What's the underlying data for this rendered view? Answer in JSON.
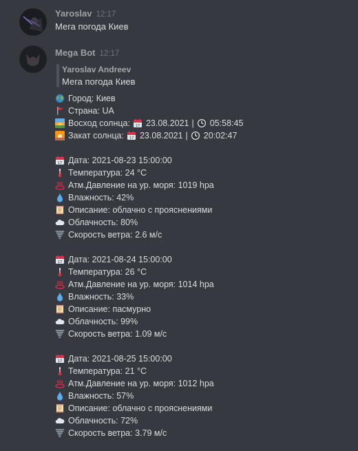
{
  "messages": [
    {
      "author": "Yaroslav",
      "time": "12:17",
      "text": "Мега погода Киев"
    },
    {
      "author": "Mega Bot",
      "time": "12:17",
      "reply": {
        "author": "Yaroslav Andreev",
        "text": "Мега погода Киев"
      },
      "city_label": "Город: Киев",
      "country_label": "Страна: UA",
      "sunrise": {
        "label": "Восход солнца:",
        "date": "23.08.2021",
        "separator": "|",
        "time": "05:58:45"
      },
      "sunset": {
        "label": "Закат солнца:",
        "date": "23.08.2021",
        "separator": "|",
        "time": "20:02:47"
      },
      "forecasts": [
        {
          "date": "Дата: 2021-08-23 15:00:00",
          "temperature": "Температура: 24 °C",
          "pressure": "Атм.Давление на ур. моря: 1019 hpa",
          "humidity": "Влажность: 42%",
          "description": "Описание: облачно с прояснениями",
          "clouds": "Облачность: 80%",
          "wind": "Скорость ветра: 2.6 м/с"
        },
        {
          "date": "Дата: 2021-08-24 15:00:00",
          "temperature": "Температура: 26 °C",
          "pressure": "Атм.Давление на ур. моря: 1014 hpa",
          "humidity": "Влажность: 33%",
          "description": "Описание: пасмурно",
          "clouds": "Облачность: 99%",
          "wind": "Скорость ветра: 1.09 м/с"
        },
        {
          "date": "Дата: 2021-08-25 15:00:00",
          "temperature": "Температура: 21 °C",
          "pressure": "Атм.Давление на ур. моря: 1012 hpa",
          "humidity": "Влажность: 57%",
          "description": "Описание: облачно с прояснениями",
          "clouds": "Облачность: 72%",
          "wind": "Скорость ветра: 3.79 м/с"
        }
      ]
    }
  ],
  "icons": {
    "city": "globe-icon",
    "country": "flag-icon",
    "sunrise": "sunrise-icon",
    "sunset": "sunset-icon",
    "calendar": "calendar-icon",
    "clock": "clock-icon",
    "temperature": "thermometer-icon",
    "pressure": "hot-springs-icon",
    "humidity": "droplet-icon",
    "description": "scroll-icon",
    "clouds": "cloud-icon",
    "wind": "tornado-icon"
  },
  "colors": {
    "background": "#36393f",
    "text": "#dcddde",
    "muted": "#72767d"
  }
}
